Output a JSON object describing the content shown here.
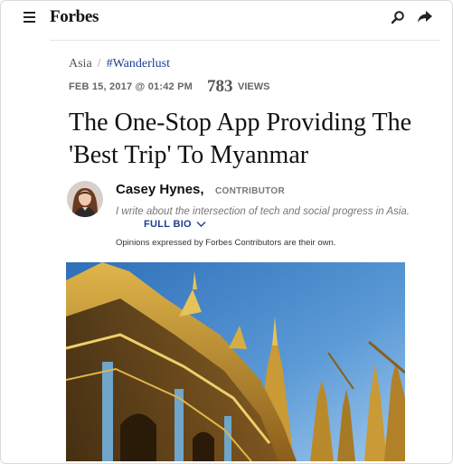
{
  "header": {
    "logo": "Forbes",
    "icons": {
      "menu": "hamburger-menu-icon",
      "search": "search-icon",
      "share": "share-arrow-icon"
    }
  },
  "breadcrumb": {
    "section": "Asia",
    "separator": "/",
    "channel": "#Wanderlust"
  },
  "meta": {
    "date": "FEB 15, 2017 @ 01:42 PM",
    "views_count": "783",
    "views_label": "VIEWS"
  },
  "article": {
    "headline": "The One-Stop App Providing The 'Best Trip' To Myanmar"
  },
  "author": {
    "name": "Casey Hynes,",
    "role": "CONTRIBUTOR",
    "bio": "I write about the intersection of tech and social progress in Asia.",
    "full_bio_label": "FULL BIO",
    "disclaimer": "Opinions expressed by Forbes Contributors are their own."
  },
  "colors": {
    "link_blue": "#1b3e8c",
    "gold": "#c9a23a",
    "sky": "#4a8fd0"
  }
}
